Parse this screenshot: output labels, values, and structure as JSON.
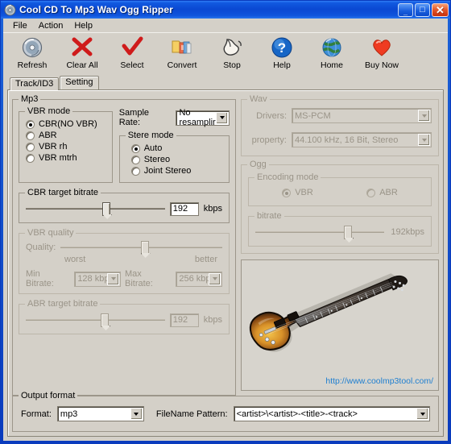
{
  "window": {
    "title": "Cool CD To Mp3 Wav Ogg Ripper",
    "icon": "cd-disc-icon",
    "minimize_label": "_",
    "maximize_label": "□",
    "close_label": "✕"
  },
  "menubar": {
    "items": [
      "File",
      "Action",
      "Help"
    ]
  },
  "toolbar": {
    "buttons": [
      {
        "label": "Refresh",
        "icon": "cd-disc-icon"
      },
      {
        "label": "Clear All",
        "icon": "red-x-icon"
      },
      {
        "label": "Select",
        "icon": "red-check-icon"
      },
      {
        "label": "Convert",
        "icon": "folder-tools-icon"
      },
      {
        "label": "Stop",
        "icon": "hand-stop-icon"
      },
      {
        "label": "Help",
        "icon": "blue-question-icon"
      },
      {
        "label": "Home",
        "icon": "globe-icon"
      },
      {
        "label": "Buy Now",
        "icon": "red-heart-icon"
      }
    ]
  },
  "tabs": [
    {
      "label": "Track/ID3",
      "active": false
    },
    {
      "label": "Setting",
      "active": true
    }
  ],
  "mp3": {
    "title": "Mp3",
    "vbr_mode": {
      "title": "VBR mode",
      "options": [
        "CBR(NO VBR)",
        "ABR",
        "VBR rh",
        "VBR mtrh"
      ],
      "selected": "CBR(NO VBR)"
    },
    "sample_rate": {
      "label": "Sample Rate:",
      "value": "No resamplir"
    },
    "stereo_mode": {
      "title": "Stere mode",
      "options": [
        "Auto",
        "Stereo",
        "Joint Stereo"
      ],
      "selected": "Auto"
    },
    "cbr_target_bitrate": {
      "title": "CBR target bitrate",
      "value": "192",
      "unit": "kbps",
      "slider_percent": 58,
      "enabled": true
    },
    "vbr_quality": {
      "title": "VBR quality",
      "label": "Quality:",
      "min_label": "worst",
      "max_label": "better",
      "slider_percent": 52,
      "min_bitrate_label": "Min Bitrate:",
      "min_bitrate_value": "128 kbp",
      "max_bitrate_label": "Max Bitrate:",
      "max_bitrate_value": "256 kbp",
      "enabled": false
    },
    "abr_target_bitrate": {
      "title": "ABR target bitrate",
      "value": "192",
      "unit": "kbps",
      "slider_percent": 57,
      "enabled": false
    }
  },
  "wav": {
    "title": "Wav",
    "drivers_label": "Drivers:",
    "drivers_value": "MS-PCM",
    "property_label": "property:",
    "property_value": "44.100 kHz, 16 Bit, Stereo",
    "enabled": false
  },
  "ogg": {
    "title": "Ogg",
    "encoding_mode": {
      "title": "Encoding mode",
      "options": [
        "VBR",
        "ABR"
      ],
      "selected": "VBR"
    },
    "bitrate": {
      "title": "bitrate",
      "value": "192kbps",
      "slider_percent": 72
    },
    "enabled": false
  },
  "promo_image": {
    "name": "electric-guitar-image",
    "url_text": "http://www.coolmp3tool.com/",
    "url_color": "#1f7fd0"
  },
  "output_format": {
    "title": "Output format",
    "format_label": "Format:",
    "format_value": "mp3",
    "filename_pattern_label": "FileName Pattern:",
    "filename_pattern_value": "<artist>\\<artist>-<title>-<track>"
  },
  "colors": {
    "window_face": "#d4d0c8",
    "title_blue": "#0a48d2",
    "disabled_text": "#9a9488",
    "link_blue": "#1f7fd0"
  }
}
